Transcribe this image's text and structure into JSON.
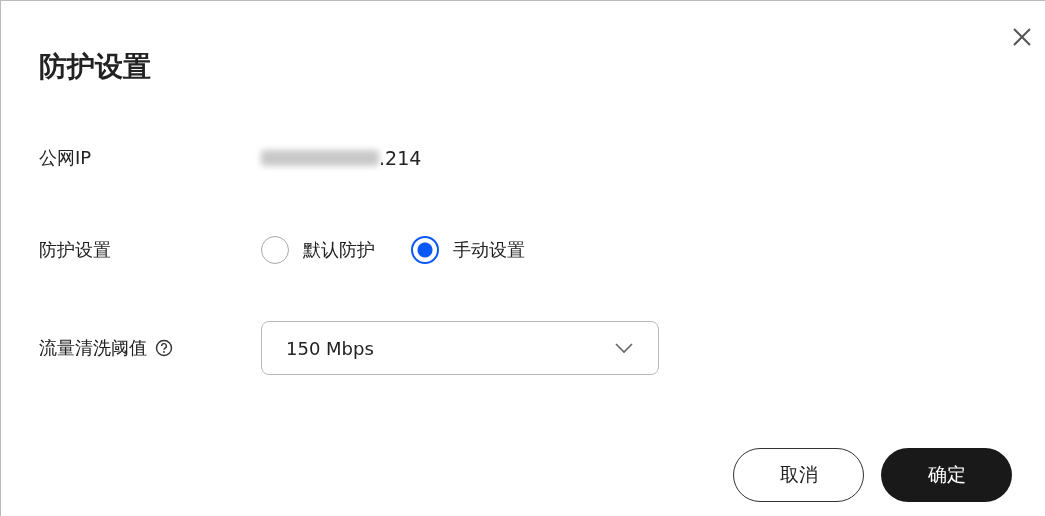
{
  "dialog": {
    "title": "防护设置"
  },
  "fields": [
    {
      "kind": "text",
      "label": "公网IP",
      "value": ".214",
      "redacted": true
    },
    {
      "kind": "radio",
      "label": "防护设置",
      "options": [
        {
          "label": "默认防护",
          "selected": false
        },
        {
          "label": "手动设置",
          "selected": true
        }
      ]
    },
    {
      "kind": "select",
      "label": "流量清洗阈值",
      "help": true,
      "value": "150 Mbps"
    }
  ],
  "buttons": [
    {
      "label": "取消",
      "kind": "secondary"
    },
    {
      "label": "确定",
      "kind": "primary"
    }
  ]
}
